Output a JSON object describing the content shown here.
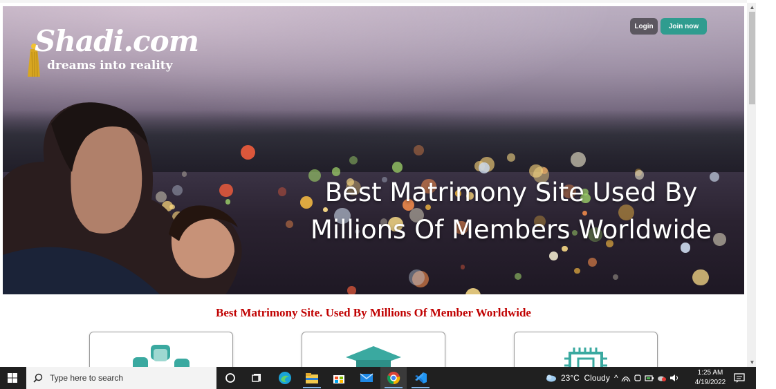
{
  "hero": {
    "brand_name": "Shadi.com",
    "brand_tagline": "dreams into reality",
    "login_label": "Login",
    "join_label": "Join now",
    "headline_line1": "Best Matrimony Site Used By",
    "headline_line2": "Millions Of Members Worldwide"
  },
  "subheading": "Best Matrimony Site. Used By Millions Of Member Worldwide",
  "cards": [
    {
      "icon": "people-icon"
    },
    {
      "icon": "graduation-cap-icon"
    },
    {
      "icon": "chip-icon"
    }
  ],
  "taskbar": {
    "search_placeholder": "Type here to search",
    "weather": "23°C  Cloudy",
    "time": "1:25 AM",
    "date": "4/19/2022",
    "apps": [
      "cortana-icon",
      "task-view-icon",
      "edge-icon",
      "file-explorer-icon",
      "store-icon",
      "mail-icon",
      "chrome-icon",
      "vscode-icon"
    ]
  },
  "colors": {
    "accent_join": "#2f9c8f",
    "login_bg": "#5c5760",
    "subheading_red": "#c00000",
    "taskbar_bg": "#202020"
  }
}
